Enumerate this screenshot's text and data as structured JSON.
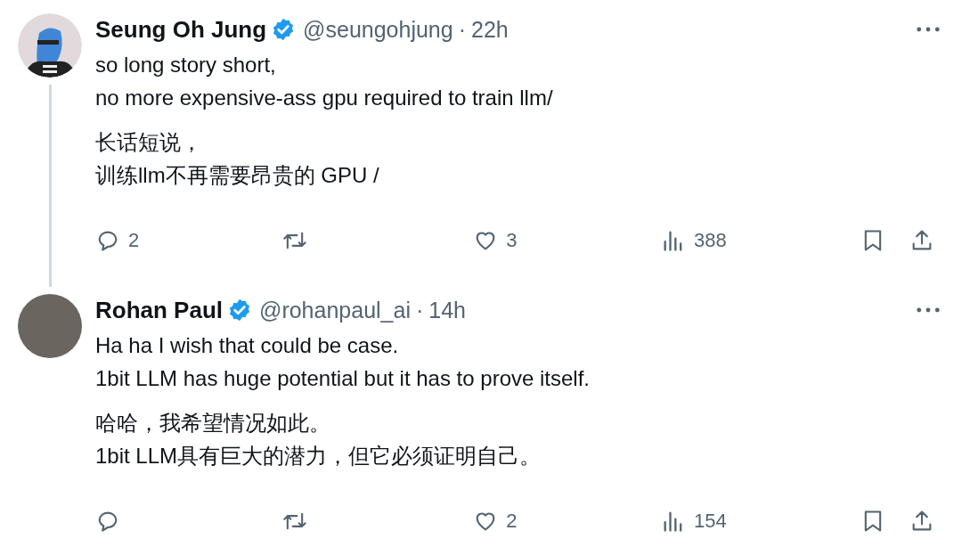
{
  "tweets": [
    {
      "avatar": {
        "kind": "cartoon"
      },
      "name": "Seung Oh Jung",
      "verified": true,
      "handle": "@seungohjung",
      "separator": "·",
      "time": "22h",
      "thread_line": true,
      "paragraphs": [
        [
          "so long story short,",
          "no more expensive-ass gpu required to train llm/"
        ],
        [
          "长话短说，",
          "训练llm不再需要昂贵的 GPU /"
        ]
      ],
      "actions": [
        {
          "kind": "reply",
          "count": "2"
        },
        {
          "kind": "repost"
        },
        {
          "kind": "like",
          "count": "3"
        },
        {
          "kind": "views",
          "count": "388"
        },
        {
          "kind": "bookmark"
        },
        {
          "kind": "share"
        }
      ]
    },
    {
      "avatar": {
        "kind": "photo"
      },
      "name": "Rohan Paul",
      "verified": true,
      "handle": "@rohanpaul_ai",
      "separator": "·",
      "time": "14h",
      "thread_line": false,
      "paragraphs": [
        [
          "Ha ha I wish that could be case.",
          "1bit LLM has huge potential but it has to prove itself."
        ],
        [
          "哈哈，我希望情况如此。",
          "1bit LLM具有巨大的潜力，但它必须证明自己。"
        ]
      ],
      "actions": [
        {
          "kind": "reply"
        },
        {
          "kind": "repost"
        },
        {
          "kind": "like",
          "count": "2"
        },
        {
          "kind": "views",
          "count": "154"
        },
        {
          "kind": "bookmark"
        },
        {
          "kind": "share"
        }
      ]
    }
  ]
}
